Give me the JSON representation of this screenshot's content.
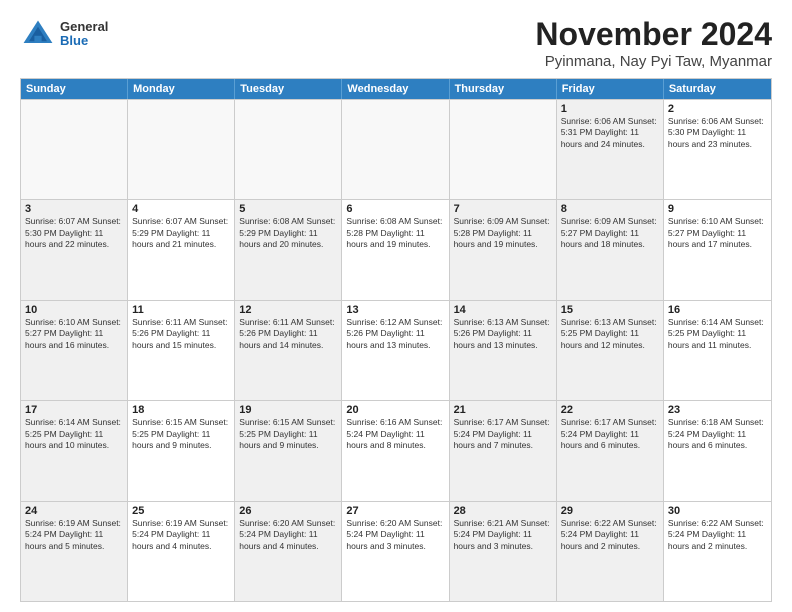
{
  "header": {
    "logo_general": "General",
    "logo_blue": "Blue",
    "title": "November 2024",
    "subtitle": "Pyinmana, Nay Pyi Taw, Myanmar"
  },
  "weekdays": [
    "Sunday",
    "Monday",
    "Tuesday",
    "Wednesday",
    "Thursday",
    "Friday",
    "Saturday"
  ],
  "rows": [
    [
      {
        "day": "",
        "info": "",
        "empty": true
      },
      {
        "day": "",
        "info": "",
        "empty": true
      },
      {
        "day": "",
        "info": "",
        "empty": true
      },
      {
        "day": "",
        "info": "",
        "empty": true
      },
      {
        "day": "",
        "info": "",
        "empty": true
      },
      {
        "day": "1",
        "info": "Sunrise: 6:06 AM\nSunset: 5:31 PM\nDaylight: 11 hours and 24 minutes.",
        "shaded": true
      },
      {
        "day": "2",
        "info": "Sunrise: 6:06 AM\nSunset: 5:30 PM\nDaylight: 11 hours and 23 minutes.",
        "shaded": false
      }
    ],
    [
      {
        "day": "3",
        "info": "Sunrise: 6:07 AM\nSunset: 5:30 PM\nDaylight: 11 hours and 22 minutes.",
        "shaded": true
      },
      {
        "day": "4",
        "info": "Sunrise: 6:07 AM\nSunset: 5:29 PM\nDaylight: 11 hours and 21 minutes."
      },
      {
        "day": "5",
        "info": "Sunrise: 6:08 AM\nSunset: 5:29 PM\nDaylight: 11 hours and 20 minutes.",
        "shaded": true
      },
      {
        "day": "6",
        "info": "Sunrise: 6:08 AM\nSunset: 5:28 PM\nDaylight: 11 hours and 19 minutes."
      },
      {
        "day": "7",
        "info": "Sunrise: 6:09 AM\nSunset: 5:28 PM\nDaylight: 11 hours and 19 minutes.",
        "shaded": true
      },
      {
        "day": "8",
        "info": "Sunrise: 6:09 AM\nSunset: 5:27 PM\nDaylight: 11 hours and 18 minutes.",
        "shaded": true
      },
      {
        "day": "9",
        "info": "Sunrise: 6:10 AM\nSunset: 5:27 PM\nDaylight: 11 hours and 17 minutes."
      }
    ],
    [
      {
        "day": "10",
        "info": "Sunrise: 6:10 AM\nSunset: 5:27 PM\nDaylight: 11 hours and 16 minutes.",
        "shaded": true
      },
      {
        "day": "11",
        "info": "Sunrise: 6:11 AM\nSunset: 5:26 PM\nDaylight: 11 hours and 15 minutes."
      },
      {
        "day": "12",
        "info": "Sunrise: 6:11 AM\nSunset: 5:26 PM\nDaylight: 11 hours and 14 minutes.",
        "shaded": true
      },
      {
        "day": "13",
        "info": "Sunrise: 6:12 AM\nSunset: 5:26 PM\nDaylight: 11 hours and 13 minutes."
      },
      {
        "day": "14",
        "info": "Sunrise: 6:13 AM\nSunset: 5:26 PM\nDaylight: 11 hours and 13 minutes.",
        "shaded": true
      },
      {
        "day": "15",
        "info": "Sunrise: 6:13 AM\nSunset: 5:25 PM\nDaylight: 11 hours and 12 minutes.",
        "shaded": true
      },
      {
        "day": "16",
        "info": "Sunrise: 6:14 AM\nSunset: 5:25 PM\nDaylight: 11 hours and 11 minutes."
      }
    ],
    [
      {
        "day": "17",
        "info": "Sunrise: 6:14 AM\nSunset: 5:25 PM\nDaylight: 11 hours and 10 minutes.",
        "shaded": true
      },
      {
        "day": "18",
        "info": "Sunrise: 6:15 AM\nSunset: 5:25 PM\nDaylight: 11 hours and 9 minutes."
      },
      {
        "day": "19",
        "info": "Sunrise: 6:15 AM\nSunset: 5:25 PM\nDaylight: 11 hours and 9 minutes.",
        "shaded": true
      },
      {
        "day": "20",
        "info": "Sunrise: 6:16 AM\nSunset: 5:24 PM\nDaylight: 11 hours and 8 minutes."
      },
      {
        "day": "21",
        "info": "Sunrise: 6:17 AM\nSunset: 5:24 PM\nDaylight: 11 hours and 7 minutes.",
        "shaded": true
      },
      {
        "day": "22",
        "info": "Sunrise: 6:17 AM\nSunset: 5:24 PM\nDaylight: 11 hours and 6 minutes.",
        "shaded": true
      },
      {
        "day": "23",
        "info": "Sunrise: 6:18 AM\nSunset: 5:24 PM\nDaylight: 11 hours and 6 minutes."
      }
    ],
    [
      {
        "day": "24",
        "info": "Sunrise: 6:19 AM\nSunset: 5:24 PM\nDaylight: 11 hours and 5 minutes.",
        "shaded": true
      },
      {
        "day": "25",
        "info": "Sunrise: 6:19 AM\nSunset: 5:24 PM\nDaylight: 11 hours and 4 minutes."
      },
      {
        "day": "26",
        "info": "Sunrise: 6:20 AM\nSunset: 5:24 PM\nDaylight: 11 hours and 4 minutes.",
        "shaded": true
      },
      {
        "day": "27",
        "info": "Sunrise: 6:20 AM\nSunset: 5:24 PM\nDaylight: 11 hours and 3 minutes."
      },
      {
        "day": "28",
        "info": "Sunrise: 6:21 AM\nSunset: 5:24 PM\nDaylight: 11 hours and 3 minutes.",
        "shaded": true
      },
      {
        "day": "29",
        "info": "Sunrise: 6:22 AM\nSunset: 5:24 PM\nDaylight: 11 hours and 2 minutes.",
        "shaded": true
      },
      {
        "day": "30",
        "info": "Sunrise: 6:22 AM\nSunset: 5:24 PM\nDaylight: 11 hours and 2 minutes."
      }
    ]
  ]
}
